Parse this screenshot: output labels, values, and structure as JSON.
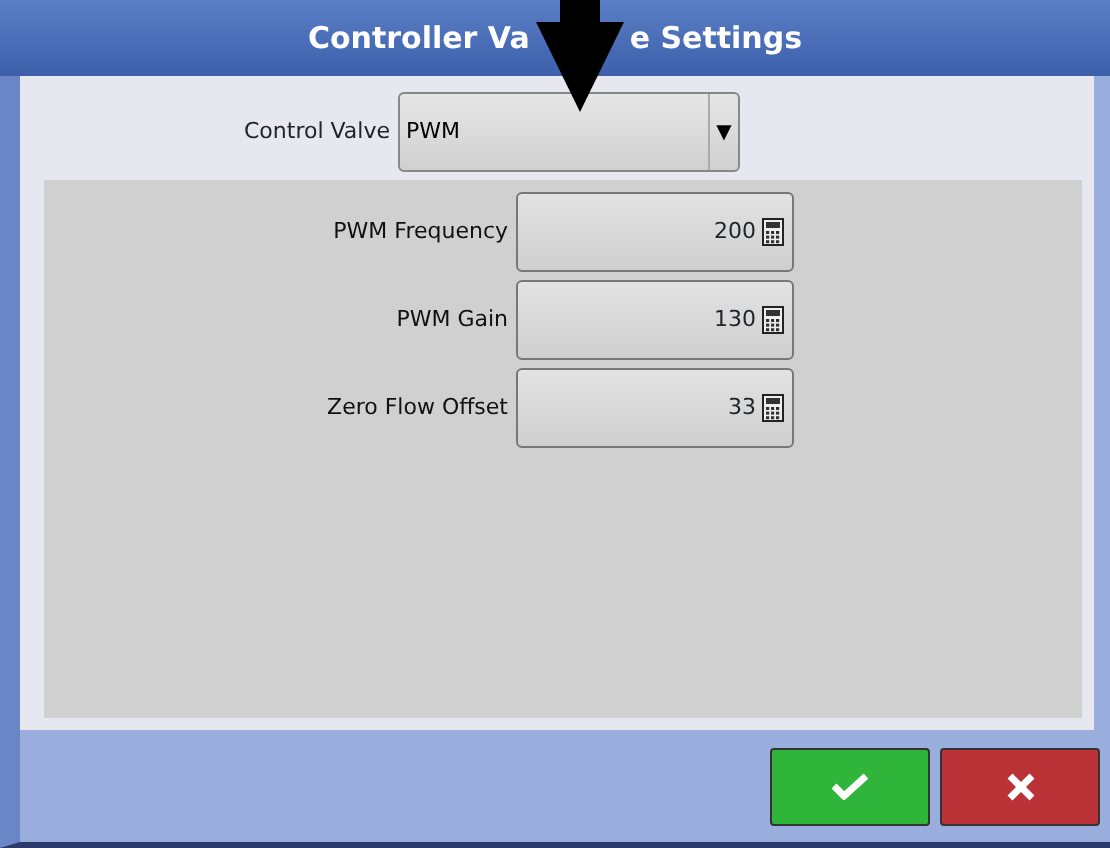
{
  "window": {
    "title_parts": [
      "Controller Va",
      "e Settings"
    ]
  },
  "control_valve": {
    "label": "Control Valve",
    "value": "PWM",
    "caret": "▼"
  },
  "fields": [
    {
      "label": "PWM Frequency",
      "value": "200"
    },
    {
      "label": "PWM Gain",
      "value": "130"
    },
    {
      "label": "Zero Flow Offset",
      "value": "33"
    }
  ],
  "buttons": [
    {
      "kind": "accept"
    },
    {
      "kind": "cancel"
    }
  ]
}
